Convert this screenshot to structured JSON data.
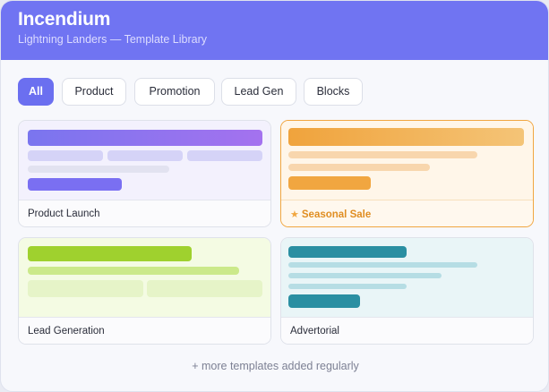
{
  "app": {
    "title": "Incendium",
    "subtitle": "Lightning Landers — Template Library"
  },
  "filters": [
    {
      "label": "All",
      "active": true
    },
    {
      "label": "Product",
      "active": false
    },
    {
      "label": "Promotion",
      "active": false
    },
    {
      "label": "Lead Gen",
      "active": false
    },
    {
      "label": "Blocks",
      "active": false
    }
  ],
  "templates": [
    {
      "name": "Product Launch",
      "selected": false,
      "accent": "#7a6ff2"
    },
    {
      "name": "Seasonal Sale",
      "selected": true,
      "accent": "#f1a640",
      "icon": "star-icon",
      "icon_glyph": "★"
    },
    {
      "name": "Lead Generation",
      "selected": false,
      "accent": "#9fd12e"
    },
    {
      "name": "Advertorial",
      "selected": false,
      "accent": "#2a8fa2"
    }
  ],
  "footer_note": "+ more templates added regularly",
  "colors": {
    "header": "#7074f2",
    "active_chip": "#6b6ff0",
    "selected_border": "#f1a640"
  }
}
